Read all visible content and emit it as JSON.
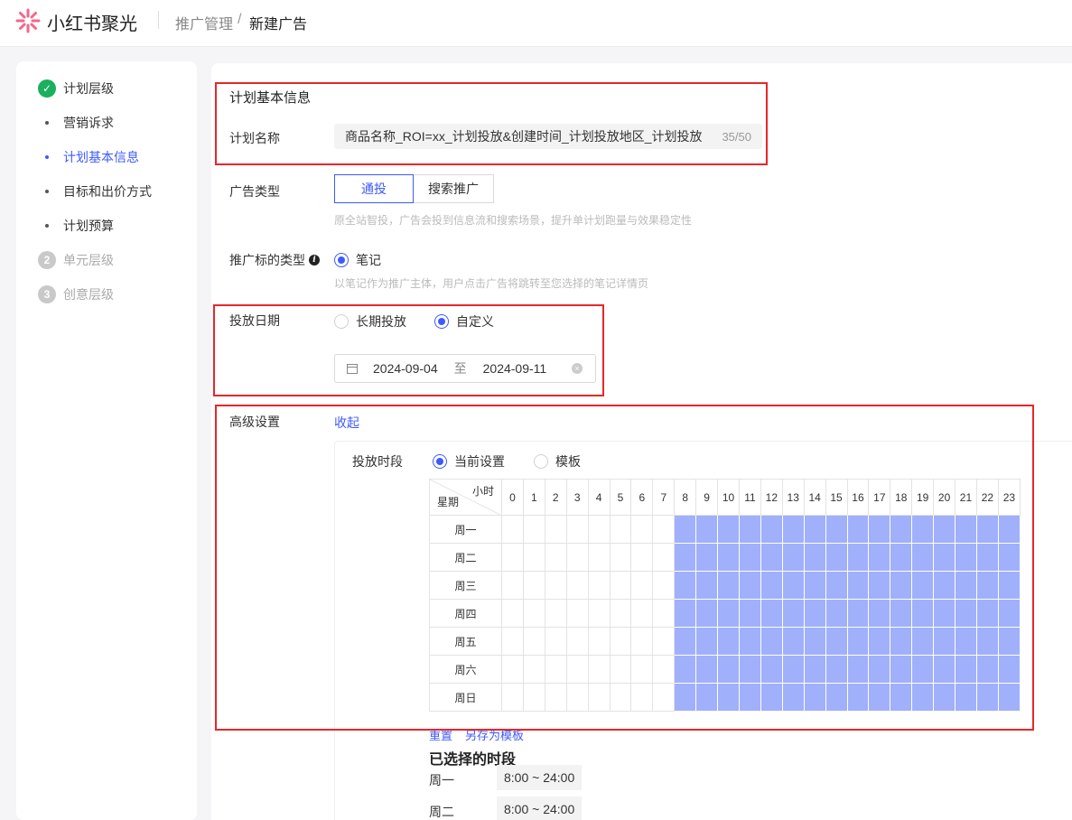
{
  "header": {
    "brand": "小红书聚光",
    "breadcrumb_parent": "推广管理",
    "breadcrumb_sep": "/",
    "breadcrumb_current": "新建广告"
  },
  "nav": {
    "level1": "计划层级",
    "sub": [
      "营销诉求",
      "计划基本信息",
      "目标和出价方式",
      "计划预算"
    ],
    "level2_num": "2",
    "level2": "单元层级",
    "level3_num": "3",
    "level3": "创意层级"
  },
  "basic": {
    "section_title": "计划基本信息",
    "name_label": "计划名称",
    "name_value": "商品名称_ROI=xx_计划投放&创建时间_计划投放地区_计划投放",
    "name_count": "35/50"
  },
  "ad_type": {
    "label": "广告类型",
    "options": [
      "通投",
      "搜索推广"
    ],
    "hint": "原全站智投，广告会投到信息流和搜索场景，提升单计划跑量与效果稳定性"
  },
  "target_type": {
    "label": "推广标的类型",
    "option": "笔记",
    "hint": "以笔记作为推广主体，用户点击广告将跳转至您选择的笔记详情页"
  },
  "schedule": {
    "label": "投放日期",
    "option_long": "长期投放",
    "option_custom": "自定义",
    "start": "2024-09-04",
    "to": "至",
    "end": "2024-09-11"
  },
  "advanced": {
    "label": "高级设置",
    "collapse": "收起",
    "period_label": "投放时段",
    "period_current": "当前设置",
    "period_template": "模板",
    "grid_hour_label": "小时",
    "grid_day_label": "星期",
    "hours": [
      "0",
      "1",
      "2",
      "3",
      "4",
      "5",
      "6",
      "7",
      "8",
      "9",
      "10",
      "11",
      "12",
      "13",
      "14",
      "15",
      "16",
      "17",
      "18",
      "19",
      "20",
      "21",
      "22",
      "23"
    ],
    "days": [
      "周一",
      "周二",
      "周三",
      "周四",
      "周五",
      "周六",
      "周日"
    ],
    "selected_from_hour": 8,
    "reset": "重置",
    "save_template": "另存为模板",
    "selected_title": "已选择的时段",
    "selected": [
      {
        "day": "周一",
        "range": "8:00 ~ 24:00"
      },
      {
        "day": "周二",
        "range": "8:00 ~ 24:00"
      }
    ]
  },
  "colors": {
    "accent": "#3d5afe",
    "selected_cell": "#a0b0fb",
    "annotation": "#e8262a",
    "done": "#1ab05d"
  }
}
